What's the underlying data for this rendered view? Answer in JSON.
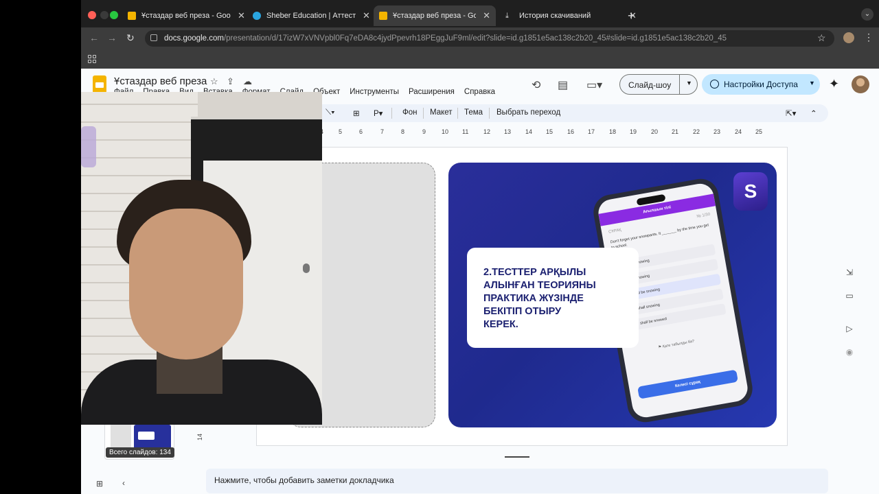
{
  "browser": {
    "tabs": [
      {
        "title": "Ұстаздар веб преза - Googl",
        "active": false
      },
      {
        "title": "Sheber Education | Аттестац",
        "active": false
      },
      {
        "title": "Ұстаздар веб преза - Googl",
        "active": true
      },
      {
        "title": "История скачиваний",
        "active": false
      }
    ],
    "url_domain": "docs.google.com",
    "url_path": "/presentation/d/17izW7xVNVpbl0Fq7eDA8c4jydPpevrh18PEggJuF9ml/edit?slide=id.g1851e5ac138c2b20_45#slide=id.g1851e5ac138c2b20_45"
  },
  "docs": {
    "title": "Ұстаздар веб преза",
    "menu": [
      "Файл",
      "Правка",
      "Вид",
      "Вставка",
      "Формат",
      "Слайд",
      "Объект",
      "Инструменты",
      "Расширения",
      "Справка"
    ],
    "slideshow_label": "Слайд-шоу",
    "share_label": "Настройки Доступа",
    "toolbar": {
      "background": "Фон",
      "layout": "Макет",
      "theme": "Тема",
      "transition": "Выбрать переход"
    },
    "ruler": [
      "4",
      "5",
      "6",
      "7",
      "8",
      "9",
      "10",
      "11",
      "12",
      "13",
      "14",
      "15",
      "16",
      "17",
      "18",
      "19",
      "20",
      "21",
      "22",
      "23",
      "24",
      "25"
    ],
    "vruler": "14",
    "thumb_tooltip": "Всего слайдов: 134",
    "notes_placeholder": "Нажмите, чтобы добавить заметки докладчика"
  },
  "slide": {
    "heading": "2.ТЕСТТЕР АРҚЫЛЫ\nАЛЫНҒАН ТЕОРИЯНЫ\nПРАКТИКА ЖҮЗІНДЕ\nБЕКІТІП ОТЫРУ\nКЕРЕК.",
    "logo_glyph": "S",
    "phone": {
      "header": "Ағылшын тілі",
      "question_label": "СҰРАҚ",
      "question_no": "№ 1/30",
      "question_text": "Don't forget your snowpants. It _______ by the time you get to school.",
      "options": [
        "will snowing",
        "is snowing",
        "will be snowing",
        "shall snowing",
        "shall be snowed"
      ],
      "selected_index": 2,
      "error_link": "Қате табылды ба?",
      "next_button": "Келесі сұрақ"
    }
  }
}
